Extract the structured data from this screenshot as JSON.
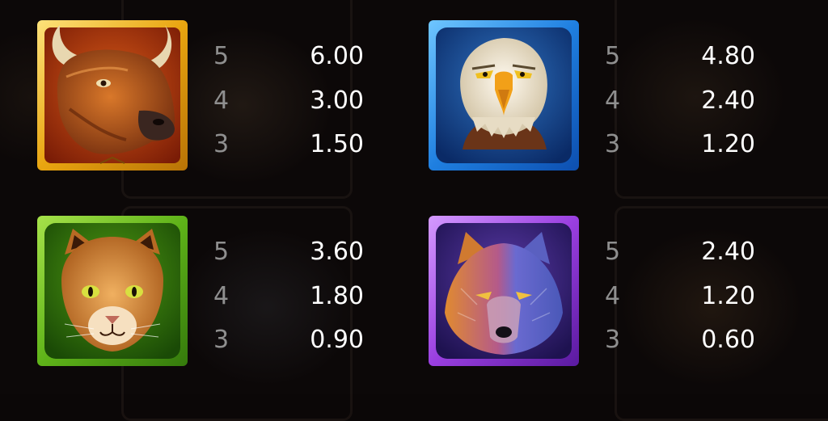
{
  "paytable": [
    {
      "symbol": "bison",
      "frame_color": "#e8a812",
      "rows": [
        {
          "count": "5",
          "payout": "6.00"
        },
        {
          "count": "4",
          "payout": "3.00"
        },
        {
          "count": "3",
          "payout": "1.50"
        }
      ]
    },
    {
      "symbol": "eagle",
      "frame_color": "#1f7fe0",
      "rows": [
        {
          "count": "5",
          "payout": "4.80"
        },
        {
          "count": "4",
          "payout": "2.40"
        },
        {
          "count": "3",
          "payout": "1.20"
        }
      ]
    },
    {
      "symbol": "cougar",
      "frame_color": "#5fb319",
      "rows": [
        {
          "count": "5",
          "payout": "3.60"
        },
        {
          "count": "4",
          "payout": "1.80"
        },
        {
          "count": "3",
          "payout": "0.90"
        }
      ]
    },
    {
      "symbol": "wolf",
      "frame_color": "#9a3fe0",
      "rows": [
        {
          "count": "5",
          "payout": "2.40"
        },
        {
          "count": "4",
          "payout": "1.20"
        },
        {
          "count": "3",
          "payout": "0.60"
        }
      ]
    }
  ]
}
